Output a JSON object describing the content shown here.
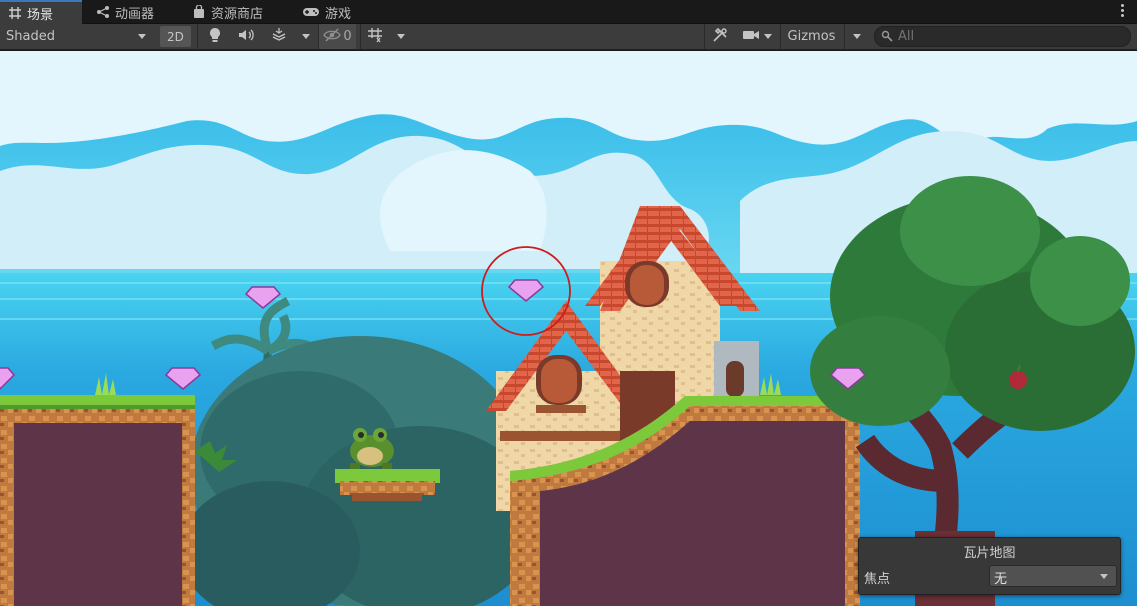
{
  "tabs": [
    {
      "label": "场景",
      "icon": "grid-icon",
      "active": true
    },
    {
      "label": "动画器",
      "icon": "animator-icon",
      "active": false
    },
    {
      "label": "资源商店",
      "icon": "store-icon",
      "active": false
    },
    {
      "label": "游戏",
      "icon": "gamepad-icon",
      "active": false
    }
  ],
  "toolbar": {
    "draw_mode": "Shaded",
    "mode_2d": "2D",
    "hidden_count": "0",
    "gizmos": "Gizmos",
    "search_placeholder": "All"
  },
  "tilemap_overlay": {
    "title": "瓦片地图",
    "focus_label": "焦点",
    "focus_value": "无"
  },
  "colors": {
    "accent": "#3a79bb",
    "sky": "#3ac4ea",
    "sea": "#2aa2dc",
    "cloud": "#e8f8ff",
    "grass": "#7cc93b",
    "dirt": "#b86a3a",
    "dirt_dark": "#5a3344",
    "gem": "#e9a0f0",
    "selection_circle": "#d02020"
  }
}
